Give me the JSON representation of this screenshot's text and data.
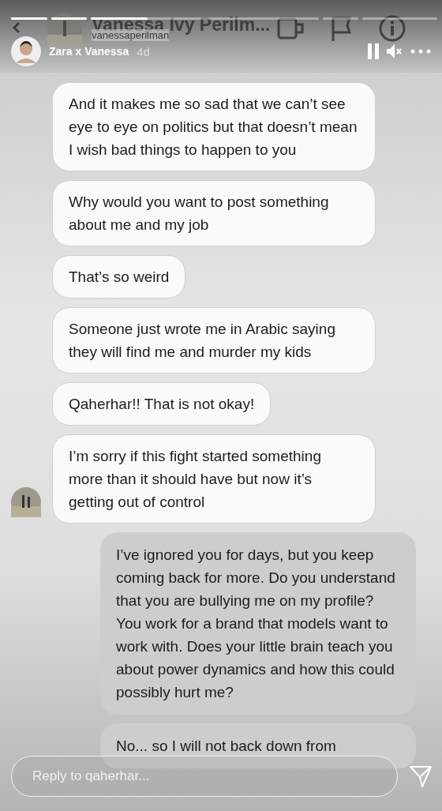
{
  "story": {
    "progress": [
      {
        "level": 1
      },
      {
        "level": 1
      },
      {
        "level": 0.25
      },
      {
        "level": 0
      },
      {
        "level": 0
      }
    ],
    "title": "Zara x Vanessa",
    "age": "4d"
  },
  "chat_header": {
    "name": "Vanessa Ivy Perilm...",
    "handle": "vanessaperilman"
  },
  "messages": [
    {
      "kind": "received",
      "text": "And it makes me so sad that we can’t see eye to eye on politics but that doesn’t mean I wish bad things to happen to you",
      "avatar": false
    },
    {
      "kind": "received",
      "text": "Why would you want to post something about me and my job",
      "avatar": false
    },
    {
      "kind": "received",
      "text": "That’s so weird",
      "avatar": false
    },
    {
      "kind": "received",
      "text": "Someone just wrote me in Arabic saying they will find me and murder my kids",
      "avatar": false
    },
    {
      "kind": "received",
      "text": "Qaherhar!! That is not okay!",
      "avatar": false
    },
    {
      "kind": "received",
      "text": "I’m sorry if this fight started something more than it should have but now it’s getting out of control",
      "avatar": true
    },
    {
      "kind": "sent",
      "text": "I’ve ignored you for days, but you keep coming back for more. Do you understand that you are bullying me on my profile? You work for a brand that models want to work with. Does your little brain teach you about power dynamics and how this could possibly hurt me?",
      "avatar": false
    },
    {
      "kind": "sent",
      "text": "No... so I will not back down from",
      "avatar": false
    }
  ],
  "reply": {
    "placeholder": "Reply to qaherhar..."
  }
}
